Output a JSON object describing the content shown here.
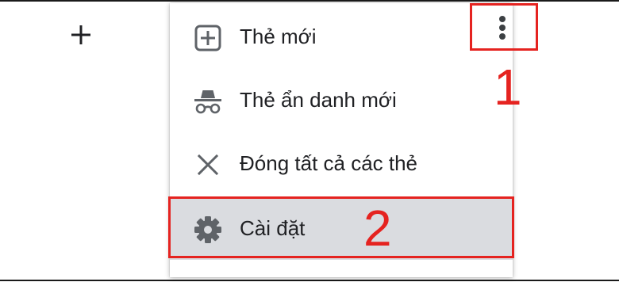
{
  "toolbar": {
    "plus_icon": "plus-icon",
    "more_icon": "vertical-ellipsis-icon"
  },
  "menu": {
    "items": [
      {
        "label": "Thẻ mới",
        "icon": "add-box-icon"
      },
      {
        "label": "Thẻ ẩn danh mới",
        "icon": "incognito-icon"
      },
      {
        "label": "Đóng tất cả các thẻ",
        "icon": "close-icon"
      },
      {
        "label": "Cài đặt",
        "icon": "gear-icon",
        "highlighted": true
      }
    ]
  },
  "annotations": {
    "step_1": "1",
    "step_2": "2",
    "color": "#e52320"
  },
  "colors": {
    "icon": "#5f6368",
    "text": "#202124",
    "highlight": "#dadce0"
  }
}
